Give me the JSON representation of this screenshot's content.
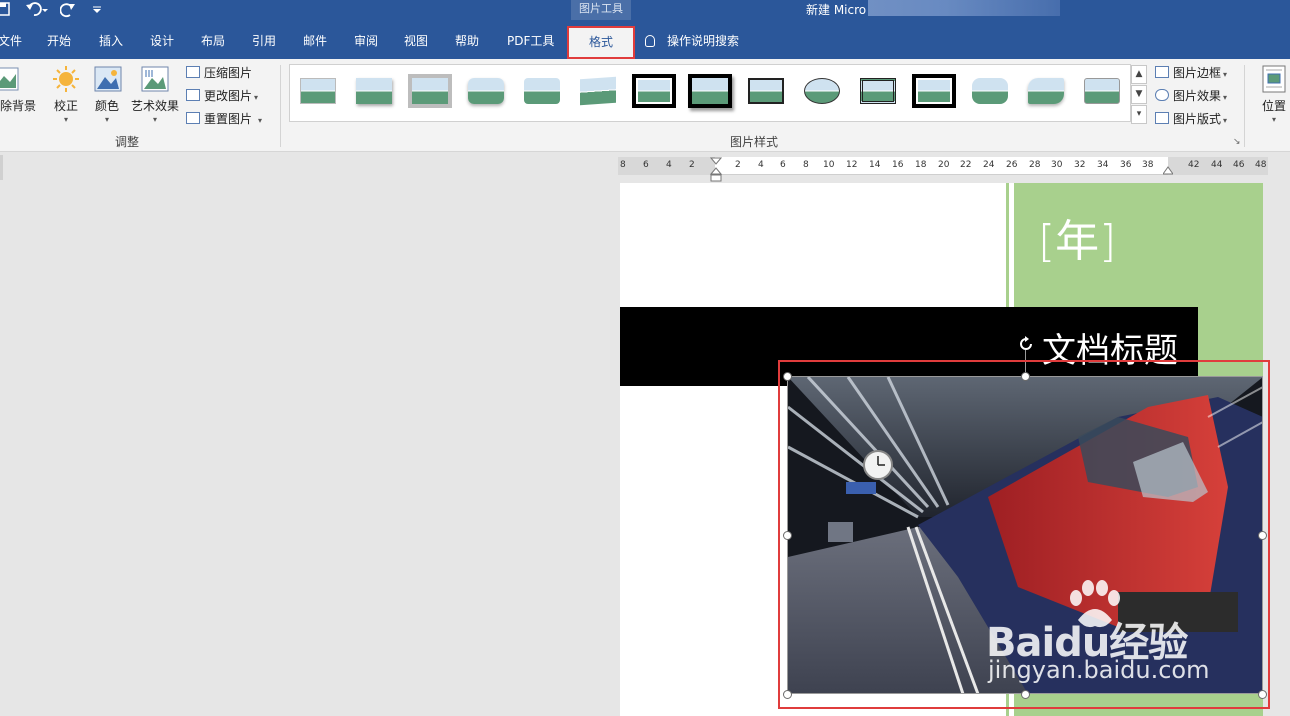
{
  "titlebar": {
    "contextual_tag": "图片工具",
    "document_title": "新建 Micro",
    "quick_access": {
      "save": "save-icon",
      "undo": "undo-icon",
      "redo": "redo-icon",
      "customize": "customize-icon"
    }
  },
  "tabs": [
    {
      "label": "文件"
    },
    {
      "label": "开始"
    },
    {
      "label": "插入"
    },
    {
      "label": "设计"
    },
    {
      "label": "布局"
    },
    {
      "label": "引用"
    },
    {
      "label": "邮件"
    },
    {
      "label": "审阅"
    },
    {
      "label": "视图"
    },
    {
      "label": "帮助"
    },
    {
      "label": "PDF工具"
    },
    {
      "label": "格式",
      "active": true
    }
  ],
  "tell_me": "操作说明搜索",
  "ribbon": {
    "adjust": {
      "remove_bg": "除背景",
      "corrections": "校正",
      "color": "颜色",
      "artistic": "艺术效果",
      "compress": "压缩图片",
      "change": "更改图片",
      "reset": "重置图片",
      "group_label": "调整"
    },
    "styles": {
      "group_label": "图片样式",
      "thumb_count": 14,
      "picture_border": "图片边框",
      "picture_effects": "图片效果",
      "picture_layout": "图片版式"
    },
    "arrange": {
      "position": "位置"
    }
  },
  "ruler": {
    "ticks": [
      "8",
      "6",
      "4",
      "2",
      "2",
      "4",
      "6",
      "8",
      "10",
      "12",
      "14",
      "16",
      "18",
      "20",
      "22",
      "24",
      "26",
      "28",
      "30",
      "32",
      "34",
      "36",
      "38",
      "42",
      "44",
      "46",
      "48"
    ]
  },
  "page": {
    "year_placeholder": "[年]",
    "doc_heading": "文档标题"
  },
  "watermark": {
    "brand": "Baidu经验",
    "url": "jingyan.baidu.com"
  },
  "colors": {
    "ribbon_blue": "#2b579a",
    "accent_green": "#a8d08d",
    "highlight_red": "#e03c3c",
    "train_red": "#c8302e"
  }
}
